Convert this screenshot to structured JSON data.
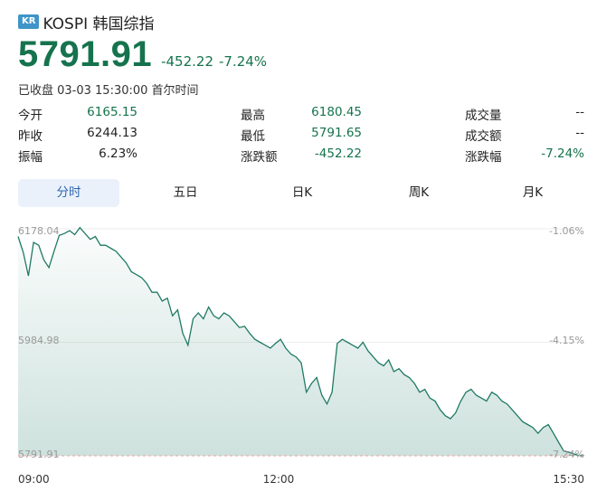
{
  "header": {
    "badge": "KR",
    "title": "KOSPI 韩国综指",
    "price": "5791.91",
    "change": "-452.22",
    "change_pct": "-7.24%",
    "status": "已收盘 03-03 15:30:00 首尔时间"
  },
  "stats": {
    "open_label": "今开",
    "open_value": "6165.15",
    "prev_close_label": "昨收",
    "prev_close_value": "6244.13",
    "amplitude_label": "振幅",
    "amplitude_value": "6.23%",
    "high_label": "最高",
    "high_value": "6180.45",
    "low_label": "最低",
    "low_value": "5791.65",
    "change_amt_label": "涨跌额",
    "change_amt_value": "-452.22",
    "volume_label": "成交量",
    "volume_value": "--",
    "turnover_label": "成交额",
    "turnover_value": "--",
    "change_pct_label": "涨跌幅",
    "change_pct_value": "-7.24%"
  },
  "tabs": [
    "分时",
    "五日",
    "日K",
    "周K",
    "月K"
  ],
  "active_tab": "分时",
  "colors": {
    "down": "#15734d",
    "tab_active_bg": "#eaf1fb",
    "tab_active_text": "#2d66b1",
    "line": "#1f7a64",
    "ref_line": "#f0a0a0"
  },
  "chart_data": {
    "type": "area",
    "y_left_ticks": [
      "6178.04",
      "5984.98",
      "5791.91"
    ],
    "y_right_ticks": [
      "-1.06%",
      "-4.15%",
      "-7.24%"
    ],
    "x_ticks": [
      "09:00",
      "12:00",
      "15:30"
    ],
    "ylim": [
      5791.91,
      6178.04
    ],
    "x_minutes": [
      0,
      3,
      6,
      9,
      12,
      15,
      18,
      21,
      24,
      27,
      30,
      33,
      36,
      39,
      42,
      45,
      48,
      51,
      54,
      57,
      60,
      63,
      66,
      69,
      72,
      75,
      78,
      81,
      84,
      87,
      90,
      93,
      96,
      99,
      102,
      105,
      108,
      111,
      114,
      117,
      120,
      123,
      126,
      129,
      132,
      135,
      138,
      141,
      144,
      147,
      150,
      153,
      156,
      159,
      162,
      165,
      168,
      171,
      174,
      177,
      180,
      183,
      186,
      189,
      192,
      195,
      198,
      201,
      204,
      207,
      210,
      213,
      216,
      219,
      222,
      225,
      228,
      231,
      234,
      237,
      240,
      243,
      246,
      249,
      252,
      255,
      258,
      261,
      264,
      267,
      270,
      273,
      276,
      279,
      282,
      285,
      288,
      291,
      294,
      297,
      300,
      303,
      306,
      309,
      312,
      315,
      318,
      321,
      324,
      327,
      330
    ],
    "values": [
      6165,
      6138,
      6098,
      6155,
      6150,
      6125,
      6112,
      6140,
      6167,
      6170,
      6175,
      6168,
      6180,
      6170,
      6160,
      6165,
      6150,
      6150,
      6145,
      6140,
      6130,
      6120,
      6105,
      6100,
      6095,
      6085,
      6070,
      6070,
      6055,
      6060,
      6030,
      6040,
      6000,
      5980,
      6025,
      6035,
      6025,
      6045,
      6030,
      6025,
      6035,
      6030,
      6020,
      6010,
      6012,
      6000,
      5990,
      5985,
      5980,
      5975,
      5983,
      5990,
      5975,
      5965,
      5960,
      5950,
      5900,
      5915,
      5925,
      5895,
      5880,
      5900,
      5983,
      5990,
      5985,
      5980,
      5975,
      5985,
      5970,
      5960,
      5950,
      5945,
      5955,
      5935,
      5940,
      5930,
      5925,
      5915,
      5900,
      5905,
      5890,
      5885,
      5870,
      5860,
      5855,
      5865,
      5885,
      5900,
      5905,
      5895,
      5890,
      5885,
      5900,
      5895,
      5885,
      5880,
      5870,
      5860,
      5850,
      5845,
      5840,
      5830,
      5840,
      5845,
      5830,
      5815,
      5800,
      5798,
      5795,
      5792,
      5792
    ],
    "ref_value": 5791.91
  }
}
